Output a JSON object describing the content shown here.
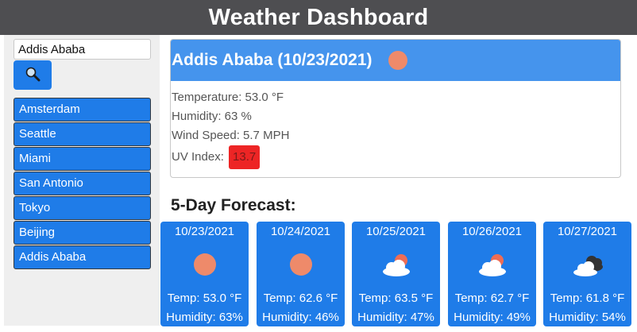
{
  "header": {
    "title": "Weather Dashboard"
  },
  "search": {
    "value": "Addis Ababa",
    "button_icon": "search-icon"
  },
  "history": [
    "Amsterdam",
    "Seattle",
    "Miami",
    "San Antonio",
    "Tokyo",
    "Beijing",
    "Addis Ababa"
  ],
  "current": {
    "title": "Addis Ababa (10/23/2021)",
    "icon": "sun-icon",
    "temperature": "Temperature: 53.0 °F",
    "humidity": "Humidity: 63 %",
    "wind": "Wind Speed: 5.7 MPH",
    "uv_label": "UV Index:",
    "uv_value": "13.7"
  },
  "forecast": {
    "title": "5-Day Forecast:",
    "days": [
      {
        "date": "10/23/2021",
        "icon": "sun-icon",
        "temp": "Temp: 53.0 °F",
        "humidity": "Humidity: 63%"
      },
      {
        "date": "10/24/2021",
        "icon": "sun-icon",
        "temp": "Temp: 62.6 °F",
        "humidity": "Humidity: 46%"
      },
      {
        "date": "10/25/2021",
        "icon": "partly-cloudy-icon",
        "temp": "Temp: 63.5 °F",
        "humidity": "Humidity: 47%"
      },
      {
        "date": "10/26/2021",
        "icon": "partly-cloudy-icon",
        "temp": "Temp: 62.7 °F",
        "humidity": "Humidity: 49%"
      },
      {
        "date": "10/27/2021",
        "icon": "cloudy-icon",
        "temp": "Temp: 61.8 °F",
        "humidity": "Humidity: 54%"
      }
    ]
  },
  "colors": {
    "header_bg": "#4e4e51",
    "accent_blue": "#1f7ce8",
    "current_header_bg": "#4594ed",
    "uv_red": "#ed2525",
    "sun": "#ee8a6a"
  }
}
